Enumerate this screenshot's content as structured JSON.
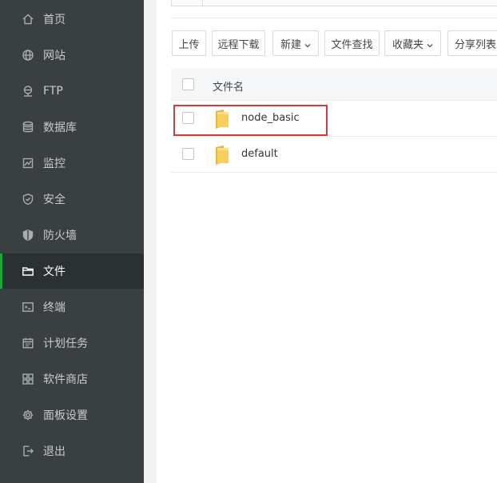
{
  "sidebar": {
    "items": [
      {
        "label": "首页",
        "icon": "home-icon"
      },
      {
        "label": "网站",
        "icon": "globe-icon"
      },
      {
        "label": "FTP",
        "icon": "ftp-icon"
      },
      {
        "label": "数据库",
        "icon": "database-icon"
      },
      {
        "label": "监控",
        "icon": "monitor-icon"
      },
      {
        "label": "安全",
        "icon": "shield-check-icon"
      },
      {
        "label": "防火墙",
        "icon": "firewall-shield-icon"
      },
      {
        "label": "文件",
        "icon": "folder-icon",
        "active": true
      },
      {
        "label": "终端",
        "icon": "terminal-icon"
      },
      {
        "label": "计划任务",
        "icon": "calendar-icon"
      },
      {
        "label": "软件商店",
        "icon": "grid-apps-icon"
      },
      {
        "label": "面板设置",
        "icon": "gear-icon"
      },
      {
        "label": "退出",
        "icon": "logout-icon"
      }
    ]
  },
  "toolbar": {
    "upload": "上传",
    "remote_download": "远程下载",
    "new": "新建",
    "file_search": "文件查找",
    "favorites": "收藏夹",
    "share_list": "分享列表"
  },
  "table": {
    "header": "文件名",
    "rows": [
      {
        "name": "node_basic"
      },
      {
        "name": "default"
      }
    ]
  },
  "colors": {
    "sidebar_bg": "#3a3f42",
    "active_accent": "#20a53a",
    "highlight": "#d83a3a",
    "folder": "#f5c84a"
  }
}
